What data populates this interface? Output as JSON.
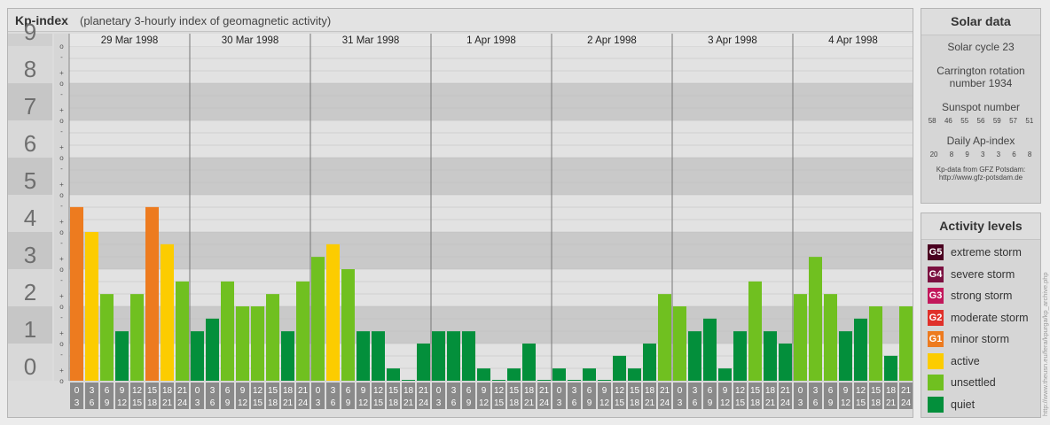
{
  "header": {
    "title": "Kp-index",
    "subtitle": "(planetary 3-hourly index of geomagnetic activity)"
  },
  "chart_data": {
    "type": "bar",
    "y_axis_labels": [
      "0",
      "1",
      "2",
      "3",
      "4",
      "5",
      "6",
      "7",
      "8",
      "9"
    ],
    "y_minor_marks": [
      "+",
      "o",
      "-"
    ],
    "ylim": [
      0,
      9
    ],
    "days": [
      "29 Mar 1998",
      "30 Mar 1998",
      "31 Mar 1998",
      "1 Apr 1998",
      "2 Apr 1998",
      "3 Apr 1998",
      "4 Apr 1998"
    ],
    "interval_top": [
      "0",
      "3",
      "6",
      "9",
      "12",
      "15",
      "18",
      "21"
    ],
    "interval_bottom": [
      "3",
      "6",
      "9",
      "12",
      "15",
      "18",
      "21",
      "24"
    ],
    "values": [
      [
        4.67,
        4.0,
        2.33,
        1.33,
        2.33,
        4.67,
        3.67,
        2.67
      ],
      [
        1.33,
        1.67,
        2.67,
        2.0,
        2.0,
        2.33,
        1.33,
        2.67
      ],
      [
        3.33,
        3.67,
        3.0,
        1.33,
        1.33,
        0.33,
        0.0,
        1.0
      ],
      [
        1.33,
        1.33,
        1.33,
        0.33,
        0.0,
        0.33,
        1.0,
        0.0
      ],
      [
        0.33,
        0.0,
        0.33,
        0.0,
        0.67,
        0.33,
        1.0,
        2.33
      ],
      [
        2.0,
        1.33,
        1.67,
        0.33,
        1.33,
        2.67,
        1.33,
        1.0
      ],
      [
        2.33,
        3.33,
        2.33,
        1.33,
        1.67,
        2.0,
        0.67,
        2.0
      ]
    ],
    "grid": true,
    "colors": {
      "quiet": "#038f3b",
      "unsettled": "#70c020",
      "active": "#fccc00",
      "minor": "#ed7b1f",
      "moderate": "#e0302a",
      "strong": "#c2185b",
      "severe": "#7b1040",
      "extreme": "#4a0020"
    }
  },
  "solar": {
    "heading": "Solar data",
    "cycle": "Solar cycle 23",
    "carrington_line1": "Carrington rotation",
    "carrington_line2": "number 1934",
    "sunspot_heading": "Sunspot number",
    "sunspot": [
      "58",
      "46",
      "55",
      "56",
      "59",
      "57",
      "51"
    ],
    "ap_heading": "Daily Ap-index",
    "ap": [
      "20",
      "8",
      "9",
      "3",
      "3",
      "6",
      "8"
    ],
    "credit_line1": "Kp-data from GFZ Potsdam:",
    "credit_line2": "http://www.gfz-potsdam.de"
  },
  "activity": {
    "heading": "Activity levels",
    "levels": [
      {
        "code": "G5",
        "label": "extreme storm",
        "color": "#4a0020"
      },
      {
        "code": "G4",
        "label": "severe storm",
        "color": "#7b1040"
      },
      {
        "code": "G3",
        "label": "strong storm",
        "color": "#c2185b"
      },
      {
        "code": "G2",
        "label": "moderate storm",
        "color": "#e0302a"
      },
      {
        "code": "G1",
        "label": "minor storm",
        "color": "#ed7b1f"
      },
      {
        "code": "",
        "label": "active",
        "color": "#fccc00"
      },
      {
        "code": "",
        "label": "unsettled",
        "color": "#70c020"
      },
      {
        "code": "",
        "label": "quiet",
        "color": "#038f3b"
      }
    ]
  },
  "side_credit": "http://www.theusn.eu/fera/kpurga/kp_archive.php"
}
